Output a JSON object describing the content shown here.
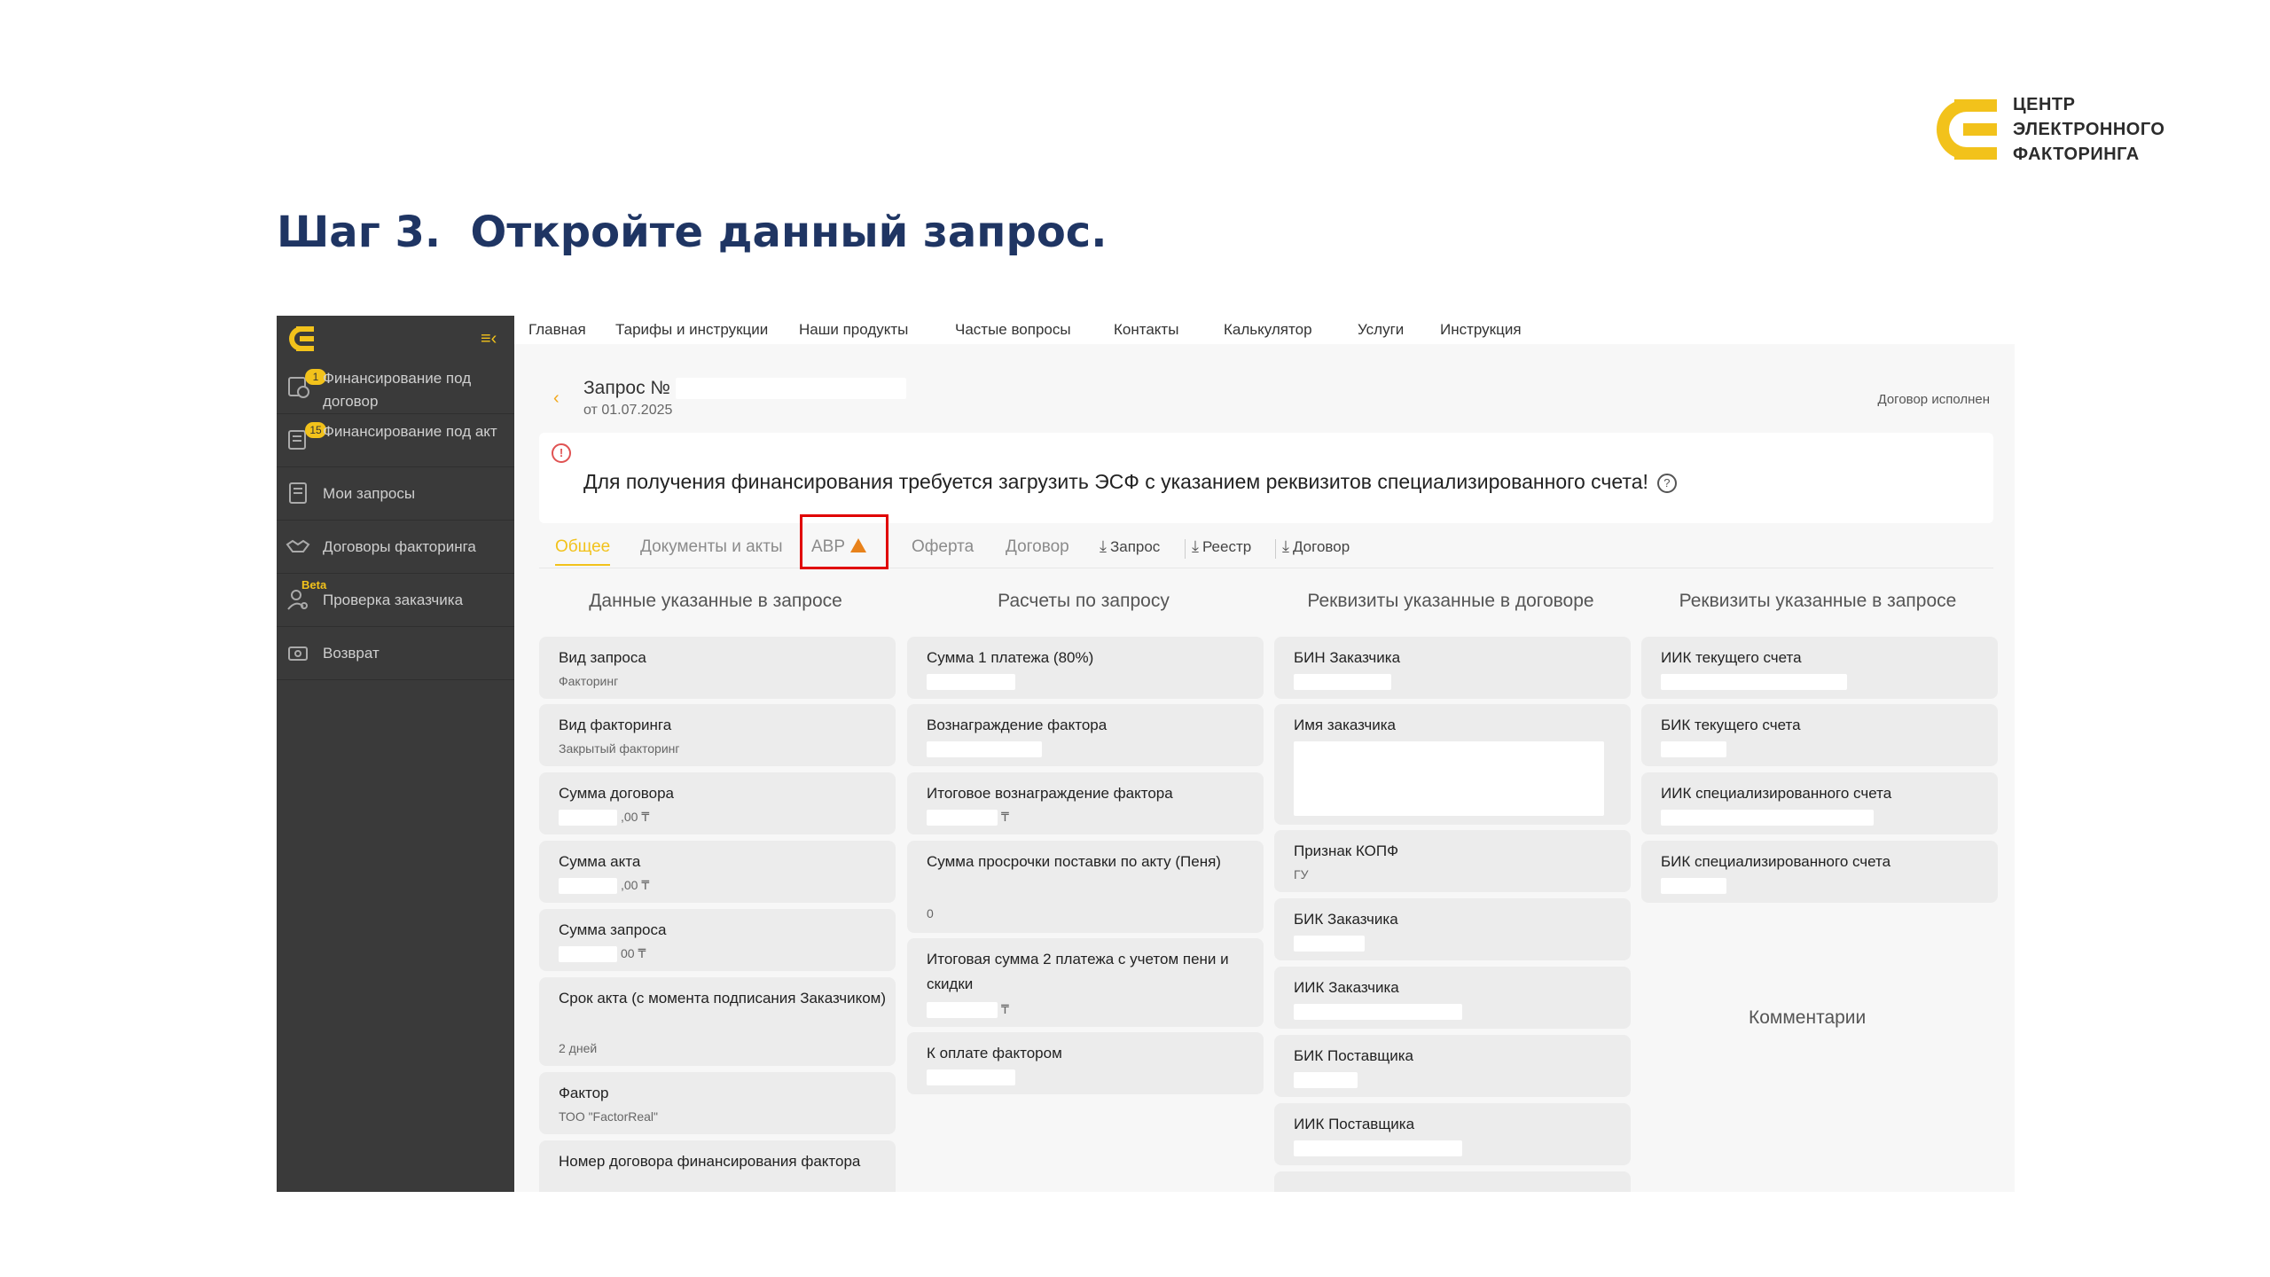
{
  "brand": {
    "line1": "ЦЕНТР",
    "line2": "ЭЛЕКТРОННОГО",
    "line3": "ФАКТОРИНГА",
    "accent": "#f2c21b"
  },
  "slide": {
    "title": "Шаг 3.  Откройте данный запрос."
  },
  "sidebar": {
    "items": [
      {
        "label": "Финансирование под договор",
        "badge": "1",
        "icon": "contract-money-icon"
      },
      {
        "label": "Финансирование под акт",
        "badge": "15",
        "icon": "act-money-icon"
      },
      {
        "label": "Мои запросы",
        "icon": "document-icon"
      },
      {
        "label": "Договоры факторинга",
        "icon": "handshake-icon"
      },
      {
        "label": "Проверка заказчика",
        "beta": "Beta",
        "icon": "user-search-icon"
      },
      {
        "label": "Возврат",
        "icon": "return-icon"
      }
    ]
  },
  "topnav": [
    "Главная",
    "Тарифы и инструкции",
    "Наши продукты",
    "Частые вопросы",
    "Контакты",
    "Калькулятор",
    "Услуги",
    "Инструкция"
  ],
  "request": {
    "title": "Запрос №",
    "date": "от 01.07.2025",
    "status": "Договор исполнен"
  },
  "alert": {
    "text": "Для получения финансирования требуется загрузить ЭСФ с указанием реквизитов специализированного счета!"
  },
  "tabs": {
    "general": "Общее",
    "docs": "Документы и акты",
    "avr": "АВР",
    "offer": "Оферта",
    "contract": "Договор",
    "dl_request": "Запрос",
    "dl_registry": "Реестр",
    "dl_contract": "Договор"
  },
  "columns": {
    "c1": {
      "title": "Данные указанные в запросе",
      "cards": [
        {
          "label": "Вид запроса",
          "value": "Факторинг"
        },
        {
          "label": "Вид факторинга",
          "value": "Закрытый факторинг"
        },
        {
          "label": "Сумма договора",
          "value": ",00 ₸"
        },
        {
          "label": "Сумма акта",
          "value": ",00 ₸"
        },
        {
          "label": "Сумма запроса",
          "value": "00 ₸"
        },
        {
          "label": "Срок акта (с момента подписания Заказчиком)",
          "value": "2 дней"
        },
        {
          "label": "Фактор",
          "value": "ТОО \"FactorReal\""
        },
        {
          "label": "Номер договора финансирования фактора",
          "value": ""
        }
      ]
    },
    "c2": {
      "title": "Расчеты по запросу",
      "cards": [
        {
          "label": "Сумма 1 платежа (80%)",
          "value": ""
        },
        {
          "label": "Вознаграждение фактора",
          "value": ""
        },
        {
          "label": "Итоговое вознаграждение фактора",
          "value": "₸"
        },
        {
          "label": "Сумма просрочки поставки по акту (Пеня)",
          "value": "0"
        },
        {
          "label": "Итоговая сумма 2 платежа с учетом пени и скидки",
          "value": "₸"
        },
        {
          "label": "К оплате фактором",
          "value": ""
        }
      ]
    },
    "c3": {
      "title": "Реквизиты указанные в договоре",
      "cards": [
        {
          "label": "БИН Заказчика",
          "value": ""
        },
        {
          "label": "Имя заказчика",
          "value": ""
        },
        {
          "label": "Признак КОПФ",
          "value": "ГУ"
        },
        {
          "label": "БИК Заказчика",
          "value": ""
        },
        {
          "label": "ИИК Заказчика",
          "value": ""
        },
        {
          "label": "БИК Поставщика",
          "value": ""
        },
        {
          "label": "ИИК Поставщика",
          "value": ""
        }
      ]
    },
    "c4": {
      "title": "Реквизиты указанные в запросе",
      "cards": [
        {
          "label": "ИИК текущего счета",
          "value": ""
        },
        {
          "label": "БИК текущего счета",
          "value": ""
        },
        {
          "label": "ИИК специализированного счета",
          "value": ""
        },
        {
          "label": "БИК специализированного счета",
          "value": ""
        }
      ],
      "comments": "Комментарии"
    }
  }
}
